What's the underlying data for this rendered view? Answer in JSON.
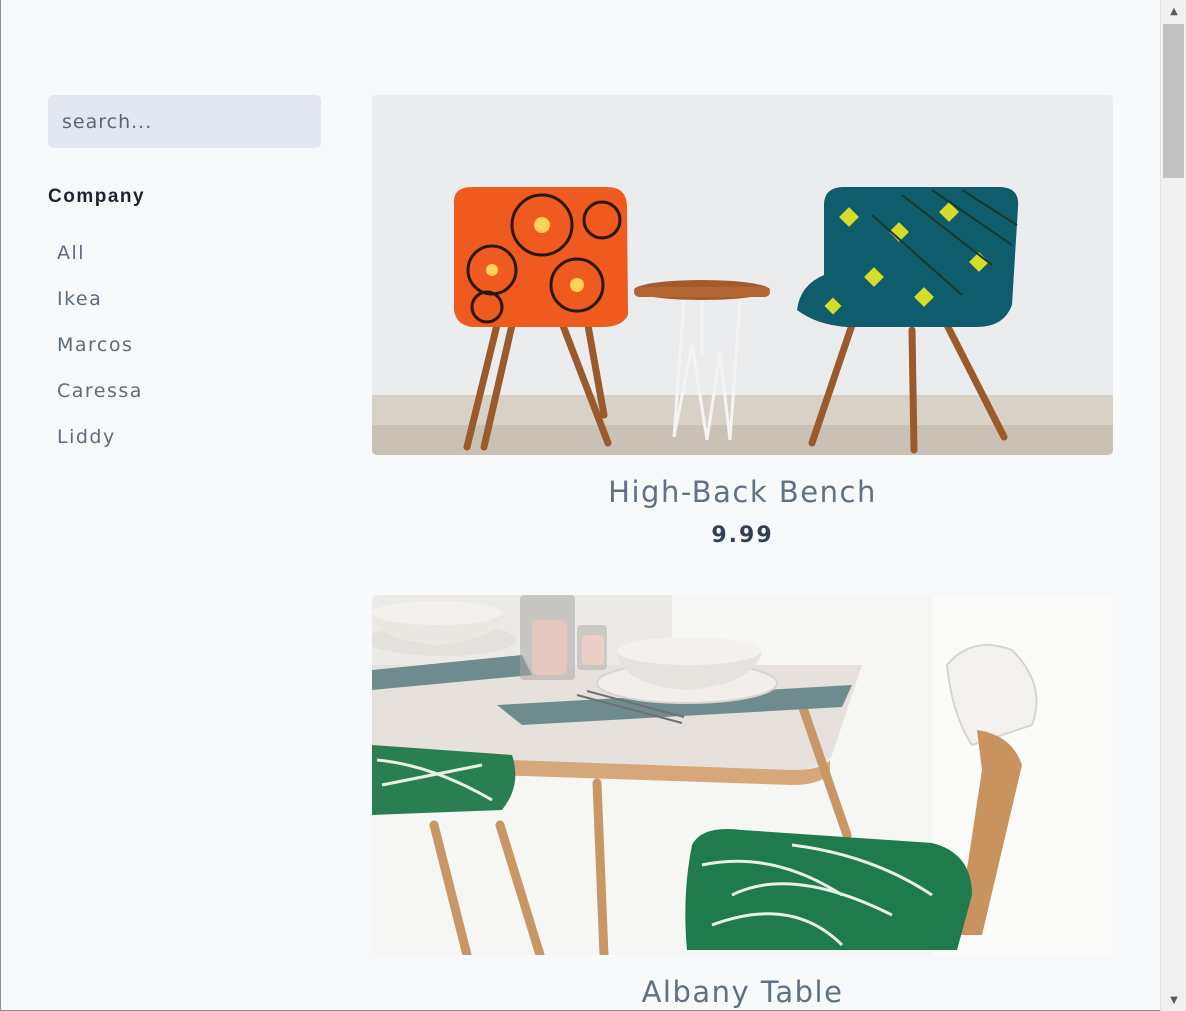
{
  "search": {
    "placeholder": "search..."
  },
  "sidebar": {
    "heading": "Company",
    "companies": [
      "All",
      "Ikea",
      "Marcos",
      "Caressa",
      "Liddy"
    ]
  },
  "products": [
    {
      "name": "High-Back Bench",
      "price": "9.99",
      "image": "two-patterned-armchairs-with-side-table-photo"
    },
    {
      "name": "Albany Table",
      "price": "",
      "image": "dining-table-with-chairs-and-bowls-photo"
    }
  ],
  "colors": {
    "background": "#f8f9fb",
    "search_bg": "#e3e8f0",
    "text_muted": "#617185",
    "text_dark": "#324054"
  }
}
